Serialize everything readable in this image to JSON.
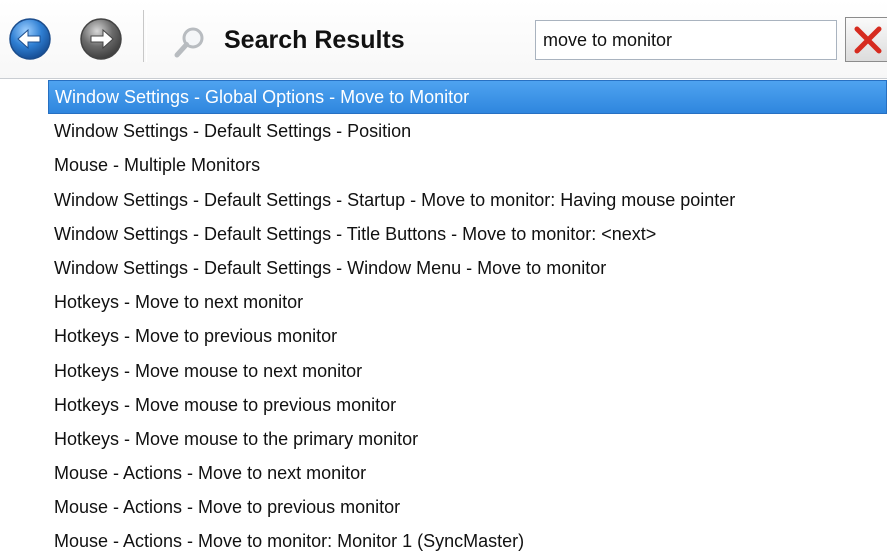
{
  "toolbar": {
    "back_icon": "back-arrow-icon",
    "forward_icon": "forward-arrow-icon",
    "search_icon": "magnifier-icon",
    "title": "Search Results",
    "search_value": "move to monitor",
    "clear_icon": "red-x-icon"
  },
  "colors": {
    "selection": "#3a8fe6",
    "back_button": "#2f7fd3",
    "forward_button": "#6b6b6b",
    "clear_x": "#d62b1f"
  },
  "results": [
    "Window Settings - Global Options - Move to Monitor",
    "Window Settings - Default Settings - Position",
    "Mouse - Multiple Monitors",
    "Window Settings - Default Settings - Startup - Move to monitor: Having mouse pointer",
    "Window Settings - Default Settings - Title Buttons - Move to monitor: <next>",
    "Window Settings - Default Settings - Window Menu - Move to monitor",
    "Hotkeys - Move to next monitor",
    "Hotkeys - Move to previous monitor",
    "Hotkeys - Move mouse to next monitor",
    "Hotkeys - Move mouse to previous monitor",
    "Hotkeys - Move mouse to the primary monitor",
    "Mouse - Actions - Move to next monitor",
    "Mouse - Actions - Move to previous monitor",
    "Mouse - Actions - Move to monitor: Monitor 1 (SyncMaster)"
  ],
  "selected_index": 0
}
